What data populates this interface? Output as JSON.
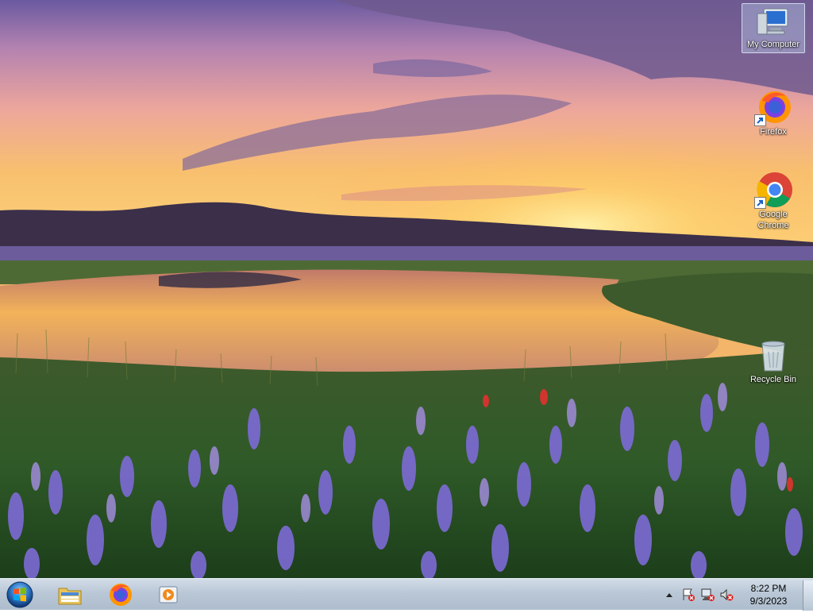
{
  "desktop": {
    "icons": [
      {
        "label": "My Computer",
        "icon": "computer-icon"
      },
      {
        "label": "Firefox",
        "icon": "firefox-icon"
      },
      {
        "label": "Google Chrome",
        "icon": "chrome-icon"
      },
      {
        "label": "Recycle Bin",
        "icon": "recycle-bin-icon"
      }
    ]
  },
  "taskbar": {
    "start_icon": "windows-logo-icon",
    "pinned": [
      {
        "icon": "file-explorer-icon"
      },
      {
        "icon": "firefox-icon"
      },
      {
        "icon": "media-player-icon"
      }
    ],
    "tray": {
      "icons": [
        "show-hidden-icons-icon",
        "action-center-alert-icon",
        "network-disconnected-icon",
        "volume-muted-icon"
      ]
    },
    "clock": {
      "time": "8:22 PM",
      "date": "9/3/2023"
    }
  }
}
